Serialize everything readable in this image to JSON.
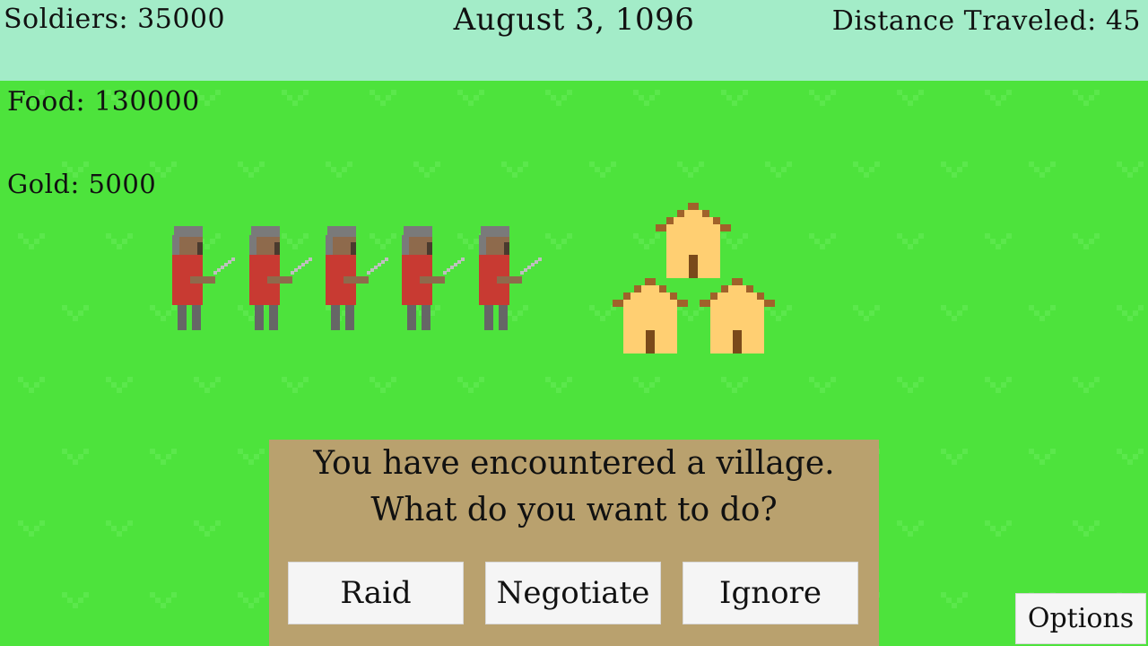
{
  "hud": {
    "soldiers": "Soldiers: 35000",
    "date": "August 3, 1096",
    "distance": "Distance Traveled: 45",
    "food": "Food: 130000",
    "gold": "Gold: 5000"
  },
  "scene": {
    "soldier_count": 5,
    "house_count": 3
  },
  "dialog": {
    "line1": "You have encountered a village.",
    "line2": "What do you want to do?",
    "buttons": [
      "Raid",
      "Negotiate",
      "Ignore"
    ]
  },
  "options_label": "Options",
  "colors": {
    "sky": "#a3ecc8",
    "grass": "#4de33c",
    "grass_pattern": "#5be84c",
    "dialog": "#b9a16e",
    "tunic": "#c83a32",
    "helmet": "#7a7a7a",
    "skin": "#8e6a4c",
    "house_wall": "#ffcf72",
    "house_roof": "#a0622a"
  }
}
